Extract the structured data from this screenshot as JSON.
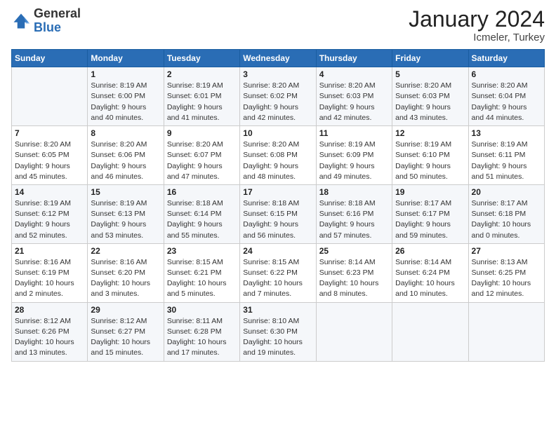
{
  "logo": {
    "general": "General",
    "blue": "Blue"
  },
  "title": "January 2024",
  "location": "Icmeler, Turkey",
  "days_header": [
    "Sunday",
    "Monday",
    "Tuesday",
    "Wednesday",
    "Thursday",
    "Friday",
    "Saturday"
  ],
  "weeks": [
    [
      {
        "num": "",
        "lines": []
      },
      {
        "num": "1",
        "lines": [
          "Sunrise: 8:19 AM",
          "Sunset: 6:00 PM",
          "Daylight: 9 hours",
          "and 40 minutes."
        ]
      },
      {
        "num": "2",
        "lines": [
          "Sunrise: 8:19 AM",
          "Sunset: 6:01 PM",
          "Daylight: 9 hours",
          "and 41 minutes."
        ]
      },
      {
        "num": "3",
        "lines": [
          "Sunrise: 8:20 AM",
          "Sunset: 6:02 PM",
          "Daylight: 9 hours",
          "and 42 minutes."
        ]
      },
      {
        "num": "4",
        "lines": [
          "Sunrise: 8:20 AM",
          "Sunset: 6:03 PM",
          "Daylight: 9 hours",
          "and 42 minutes."
        ]
      },
      {
        "num": "5",
        "lines": [
          "Sunrise: 8:20 AM",
          "Sunset: 6:03 PM",
          "Daylight: 9 hours",
          "and 43 minutes."
        ]
      },
      {
        "num": "6",
        "lines": [
          "Sunrise: 8:20 AM",
          "Sunset: 6:04 PM",
          "Daylight: 9 hours",
          "and 44 minutes."
        ]
      }
    ],
    [
      {
        "num": "7",
        "lines": [
          "Sunrise: 8:20 AM",
          "Sunset: 6:05 PM",
          "Daylight: 9 hours",
          "and 45 minutes."
        ]
      },
      {
        "num": "8",
        "lines": [
          "Sunrise: 8:20 AM",
          "Sunset: 6:06 PM",
          "Daylight: 9 hours",
          "and 46 minutes."
        ]
      },
      {
        "num": "9",
        "lines": [
          "Sunrise: 8:20 AM",
          "Sunset: 6:07 PM",
          "Daylight: 9 hours",
          "and 47 minutes."
        ]
      },
      {
        "num": "10",
        "lines": [
          "Sunrise: 8:20 AM",
          "Sunset: 6:08 PM",
          "Daylight: 9 hours",
          "and 48 minutes."
        ]
      },
      {
        "num": "11",
        "lines": [
          "Sunrise: 8:19 AM",
          "Sunset: 6:09 PM",
          "Daylight: 9 hours",
          "and 49 minutes."
        ]
      },
      {
        "num": "12",
        "lines": [
          "Sunrise: 8:19 AM",
          "Sunset: 6:10 PM",
          "Daylight: 9 hours",
          "and 50 minutes."
        ]
      },
      {
        "num": "13",
        "lines": [
          "Sunrise: 8:19 AM",
          "Sunset: 6:11 PM",
          "Daylight: 9 hours",
          "and 51 minutes."
        ]
      }
    ],
    [
      {
        "num": "14",
        "lines": [
          "Sunrise: 8:19 AM",
          "Sunset: 6:12 PM",
          "Daylight: 9 hours",
          "and 52 minutes."
        ]
      },
      {
        "num": "15",
        "lines": [
          "Sunrise: 8:19 AM",
          "Sunset: 6:13 PM",
          "Daylight: 9 hours",
          "and 53 minutes."
        ]
      },
      {
        "num": "16",
        "lines": [
          "Sunrise: 8:18 AM",
          "Sunset: 6:14 PM",
          "Daylight: 9 hours",
          "and 55 minutes."
        ]
      },
      {
        "num": "17",
        "lines": [
          "Sunrise: 8:18 AM",
          "Sunset: 6:15 PM",
          "Daylight: 9 hours",
          "and 56 minutes."
        ]
      },
      {
        "num": "18",
        "lines": [
          "Sunrise: 8:18 AM",
          "Sunset: 6:16 PM",
          "Daylight: 9 hours",
          "and 57 minutes."
        ]
      },
      {
        "num": "19",
        "lines": [
          "Sunrise: 8:17 AM",
          "Sunset: 6:17 PM",
          "Daylight: 9 hours",
          "and 59 minutes."
        ]
      },
      {
        "num": "20",
        "lines": [
          "Sunrise: 8:17 AM",
          "Sunset: 6:18 PM",
          "Daylight: 10 hours",
          "and 0 minutes."
        ]
      }
    ],
    [
      {
        "num": "21",
        "lines": [
          "Sunrise: 8:16 AM",
          "Sunset: 6:19 PM",
          "Daylight: 10 hours",
          "and 2 minutes."
        ]
      },
      {
        "num": "22",
        "lines": [
          "Sunrise: 8:16 AM",
          "Sunset: 6:20 PM",
          "Daylight: 10 hours",
          "and 3 minutes."
        ]
      },
      {
        "num": "23",
        "lines": [
          "Sunrise: 8:15 AM",
          "Sunset: 6:21 PM",
          "Daylight: 10 hours",
          "and 5 minutes."
        ]
      },
      {
        "num": "24",
        "lines": [
          "Sunrise: 8:15 AM",
          "Sunset: 6:22 PM",
          "Daylight: 10 hours",
          "and 7 minutes."
        ]
      },
      {
        "num": "25",
        "lines": [
          "Sunrise: 8:14 AM",
          "Sunset: 6:23 PM",
          "Daylight: 10 hours",
          "and 8 minutes."
        ]
      },
      {
        "num": "26",
        "lines": [
          "Sunrise: 8:14 AM",
          "Sunset: 6:24 PM",
          "Daylight: 10 hours",
          "and 10 minutes."
        ]
      },
      {
        "num": "27",
        "lines": [
          "Sunrise: 8:13 AM",
          "Sunset: 6:25 PM",
          "Daylight: 10 hours",
          "and 12 minutes."
        ]
      }
    ],
    [
      {
        "num": "28",
        "lines": [
          "Sunrise: 8:12 AM",
          "Sunset: 6:26 PM",
          "Daylight: 10 hours",
          "and 13 minutes."
        ]
      },
      {
        "num": "29",
        "lines": [
          "Sunrise: 8:12 AM",
          "Sunset: 6:27 PM",
          "Daylight: 10 hours",
          "and 15 minutes."
        ]
      },
      {
        "num": "30",
        "lines": [
          "Sunrise: 8:11 AM",
          "Sunset: 6:28 PM",
          "Daylight: 10 hours",
          "and 17 minutes."
        ]
      },
      {
        "num": "31",
        "lines": [
          "Sunrise: 8:10 AM",
          "Sunset: 6:30 PM",
          "Daylight: 10 hours",
          "and 19 minutes."
        ]
      },
      {
        "num": "",
        "lines": []
      },
      {
        "num": "",
        "lines": []
      },
      {
        "num": "",
        "lines": []
      }
    ]
  ]
}
